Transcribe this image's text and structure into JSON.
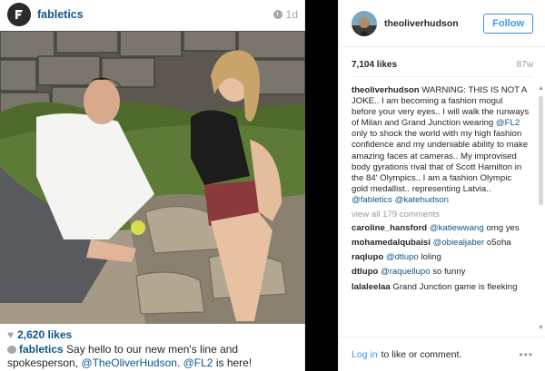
{
  "post": {
    "username": "fabletics",
    "time": "1d",
    "likes": "2,620 likes",
    "caption": {
      "user": "fabletics",
      "text_1": " Say hello to our new men's line and spokesperson, ",
      "mention_1": "@TheOliverHudson",
      "text_2": ". ",
      "mention_2": "@FL2",
      "text_3": " is here!"
    }
  },
  "detail": {
    "username": "theoliverhudson",
    "follow_label": "Follow",
    "likes": "7,104 likes",
    "age": "87w",
    "caption": {
      "user": "theoliverhudson",
      "text_1": " WARNING: THIS IS NOT A JOKE.. I am becoming a fashion mogul before your very eyes.. I will walk the runways of Milan and Grand Junction wearing ",
      "mention_1": "@FL2",
      "text_2": " only to shock the world with my high fashion confidence and my undeniable ability to make amazing faces at cameras.. My improvised body gyrations rival that of Scott Hamilton in the 84' Olympics.. I am a fashion Olympic gold medallist.. representing Latvia.. ",
      "mention_2": "@fabletics",
      "text_3": " ",
      "mention_3": "@katehudson"
    },
    "view_all": "view all 179 comments",
    "comments": [
      {
        "user": "caroline_hansford",
        "mention": "@katiewwang",
        "text": " omg yes"
      },
      {
        "user": "mohamedalqubaisi",
        "mention": "@obiealjaber",
        "text": " o5oha"
      },
      {
        "user": "raqlupo",
        "mention": "@dtlupo",
        "text": " loling"
      },
      {
        "user": "dtlupo",
        "mention": "@raquellupo",
        "text": " so funny"
      },
      {
        "user": "lalaleelaa",
        "mention": "",
        "text": " Grand Junction game is fleeking"
      }
    ],
    "footer": {
      "login": "Log in",
      "suffix": "to like or comment."
    }
  }
}
